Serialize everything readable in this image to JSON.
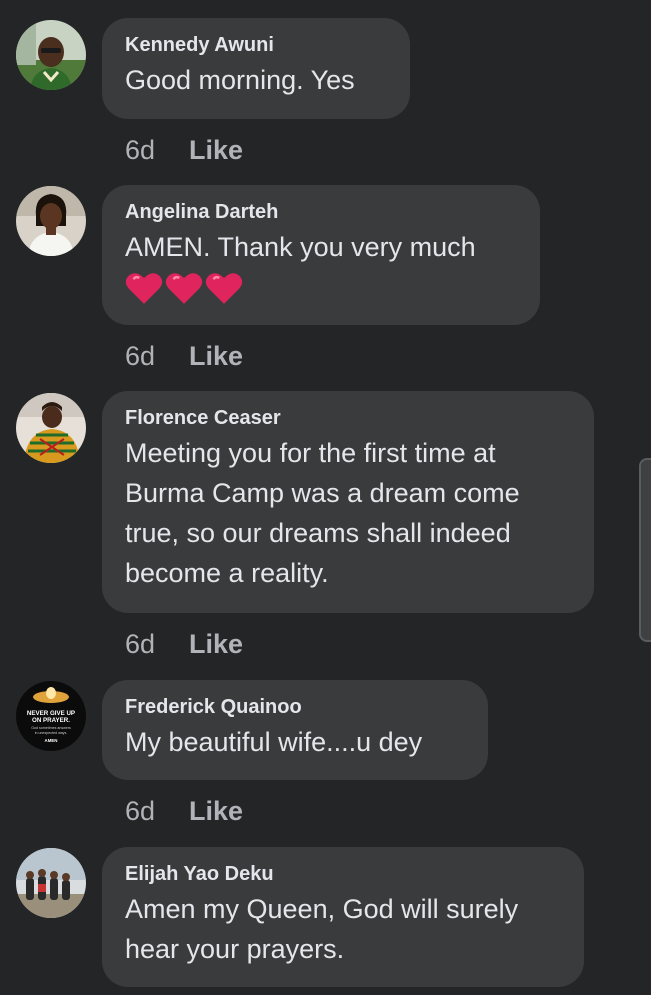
{
  "comments": [
    {
      "author": "Kennedy Awuni",
      "text": "Good morning. Yes",
      "time": "6d",
      "like_label": "Like",
      "avatar_icon": "man-in-green-shirt-photo"
    },
    {
      "author": "Angelina Darteh",
      "text": "AMEN. Thank you very much",
      "reactions": "❤️❤️❤️",
      "time": "6d",
      "like_label": "Like",
      "avatar_icon": "woman-white-top-photo"
    },
    {
      "author": "Florence Ceaser",
      "text": "Meeting you for the first time at Burma Camp was a dream come true, so our dreams shall indeed become a reality.",
      "time": "6d",
      "like_label": "Like",
      "avatar_icon": "woman-kente-photo"
    },
    {
      "author": "Frederick Quainoo",
      "text": "My beautiful wife....u dey",
      "time": "6d",
      "like_label": "Like",
      "avatar_icon": "never-give-up-on-prayer-poster",
      "avatar_text": {
        "line1": "NEVER GIVE UP",
        "line2": "ON PRAYER.",
        "line3": "God sometimes answers",
        "line4": "in unexpected ways.",
        "line5": "AMEN"
      }
    },
    {
      "author": "Elijah Yao Deku",
      "text": "Amen my Queen, God will surely hear your prayers.",
      "avatar_icon": "group-photo-outdoors"
    }
  ],
  "colors": {
    "background": "#242526",
    "bubble": "#3a3b3c",
    "primary_text": "#e4e6eb",
    "secondary_text": "#b0b3b8",
    "heart": "#e0245e"
  }
}
